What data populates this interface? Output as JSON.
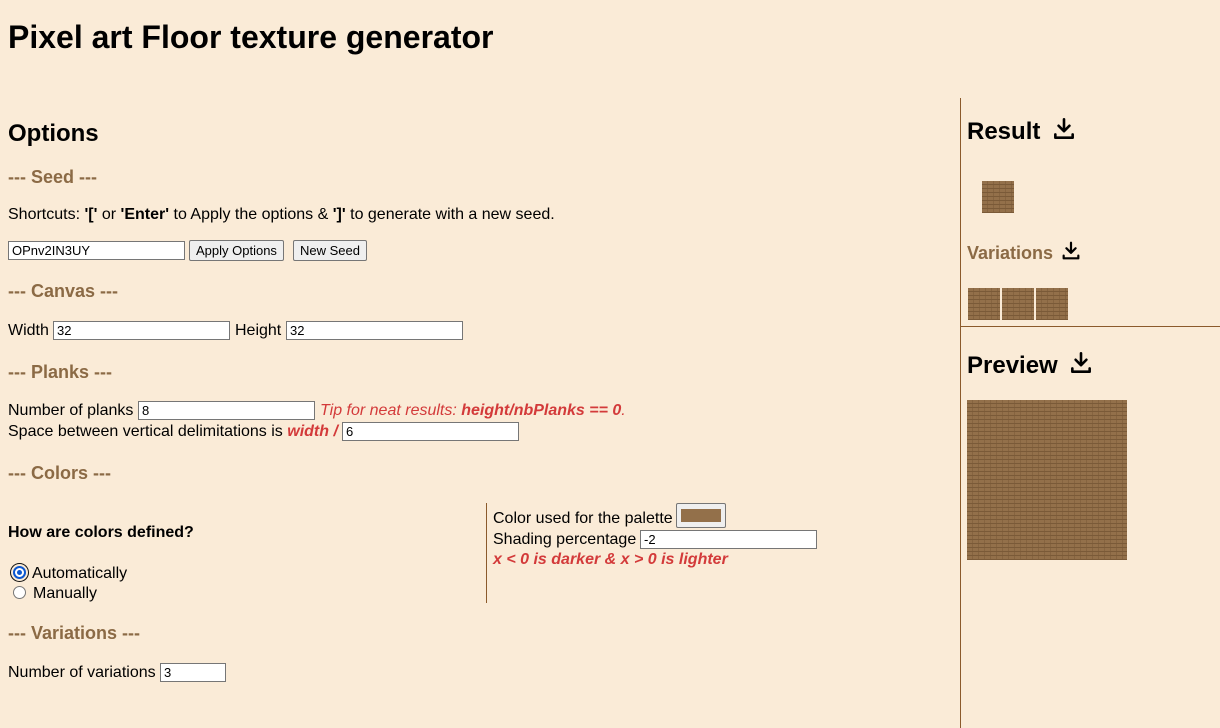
{
  "page": {
    "title": "Pixel art Floor texture generator"
  },
  "options": {
    "title": "Options",
    "seed": {
      "heading": "--- Seed ---",
      "shortcuts_prefix": "Shortcuts: ",
      "key1": "'['",
      "or": " or ",
      "key2": "'Enter'",
      "mid": " to Apply the options & ",
      "key3": "']'",
      "suffix": " to generate with a new seed.",
      "value": "OPnv2IN3UY",
      "apply_label": "Apply Options",
      "new_seed_label": "New Seed"
    },
    "canvas": {
      "heading": "--- Canvas ---",
      "width_label": "Width",
      "width_value": "32",
      "height_label": "Height",
      "height_value": "32"
    },
    "planks": {
      "heading": "--- Planks ---",
      "number_label": "Number of planks",
      "number_value": "8",
      "tip_text": "Tip for neat results: ",
      "tip_formula": "height/nbPlanks == 0",
      "tip_end": ".",
      "space_label": "Space between vertical delimitations is ",
      "space_formula": "width /",
      "space_value": "6"
    },
    "colors": {
      "heading": "--- Colors ---",
      "question": "How are colors defined?",
      "auto_label": "Automatically",
      "manual_label": "Manually",
      "selected": "Automatically",
      "palette_label": "Color used for the palette",
      "palette_color": "#93704a",
      "shading_label": "Shading percentage",
      "shading_value": "-2",
      "shading_hint": "x < 0 is darker & x > 0 is lighter"
    },
    "variations": {
      "heading": "--- Variations ---",
      "number_label": "Number of variations",
      "number_value": "3"
    }
  },
  "result": {
    "title": "Result",
    "variations_title": "Variations",
    "preview_title": "Preview",
    "icon": "download-icon"
  },
  "colors": {
    "background": "#faebd7",
    "section_heading": "#8b6a45",
    "tip_red": "#d33a3a",
    "texture": "#93704a",
    "divider": "#8b5a2b"
  }
}
